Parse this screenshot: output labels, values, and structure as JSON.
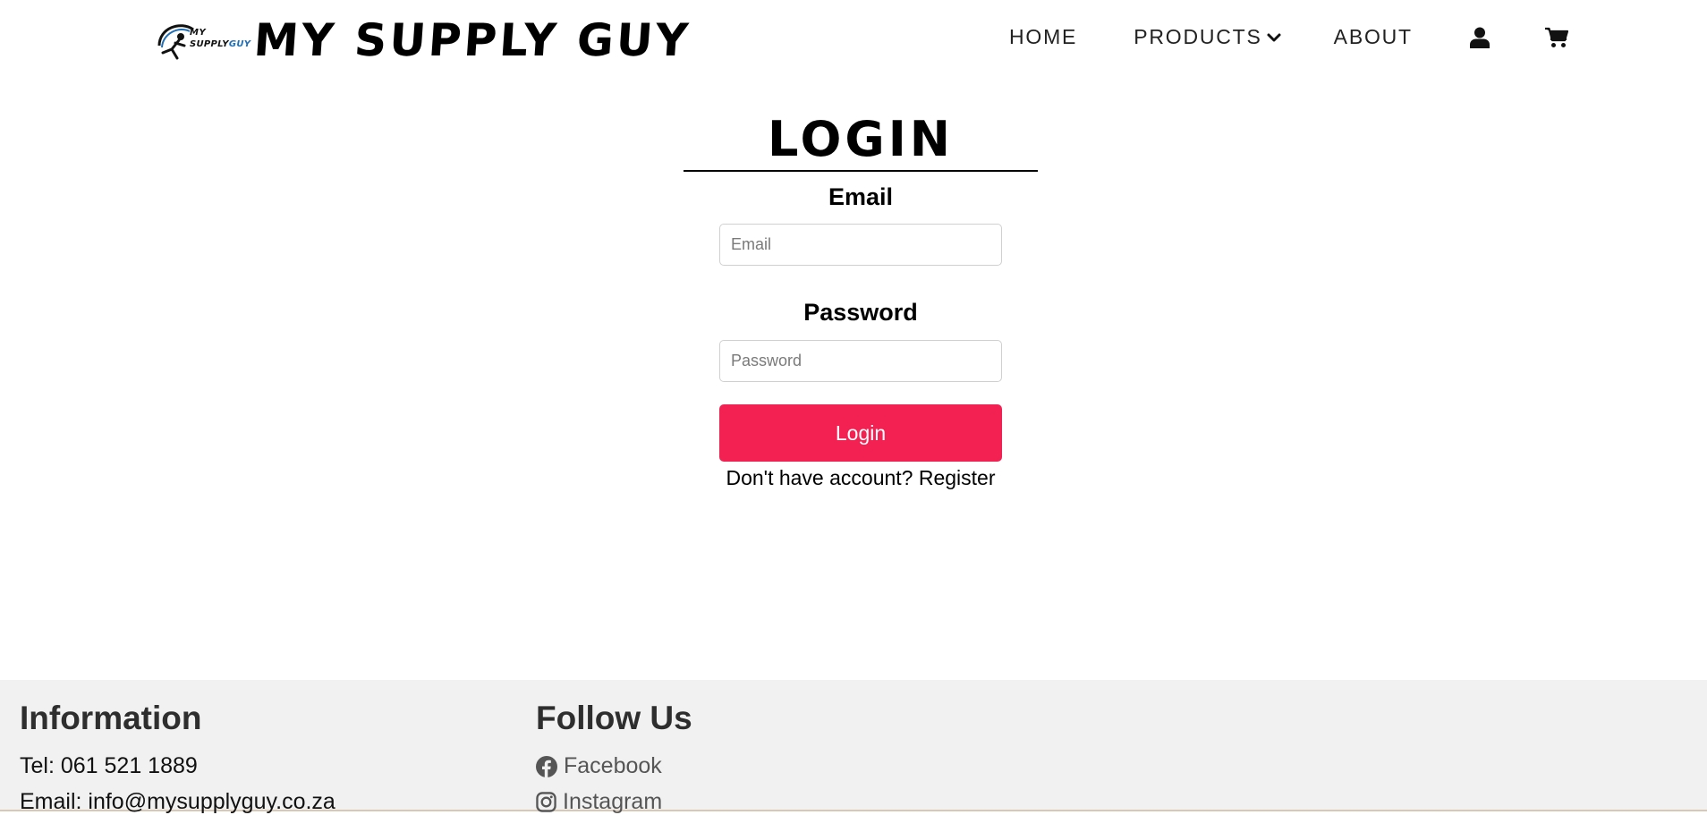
{
  "header": {
    "logo": {
      "line1": "MY",
      "line2_a": "SUPPLY",
      "line2_b": "GUY",
      "colors": {
        "dark": "#111111",
        "accent": "#1e6fb8"
      }
    },
    "site_title": "MY SUPPLY GUY",
    "nav": {
      "home": "HOME",
      "products": "PRODUCTS",
      "about": "ABOUT",
      "products_icon": "chevron-down-icon",
      "account_icon": "user-icon",
      "cart_icon": "cart-icon"
    }
  },
  "login": {
    "title": "LOGIN",
    "email_label": "Email",
    "email_placeholder": "Email",
    "email_value": "",
    "password_label": "Password",
    "password_placeholder": "Password",
    "password_value": "",
    "button_label": "Login",
    "button_color": "#f32152",
    "register_prompt": "Don't have account?",
    "register_link": "Register"
  },
  "footer": {
    "info_heading": "Information",
    "tel": "Tel: 061 521 1889",
    "email": "Email: info@mysupplyguy.co.za",
    "follow_heading": "Follow Us",
    "social": [
      {
        "label": "Facebook",
        "icon": "facebook-icon"
      },
      {
        "label": "Instagram",
        "icon": "instagram-icon"
      }
    ],
    "background": "#f1f1f1"
  }
}
